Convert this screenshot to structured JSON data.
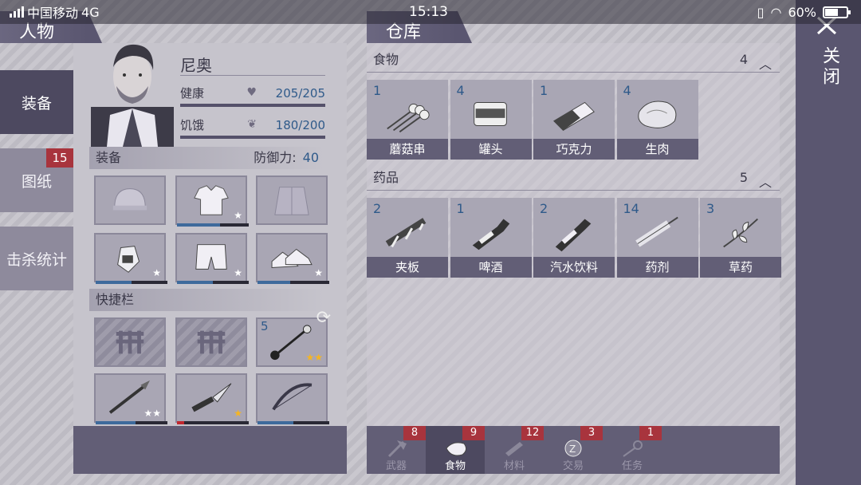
{
  "status_bar": {
    "carrier": "中国移动",
    "network": "4G",
    "time": "15:13",
    "battery": "60%",
    "battery_level": 0.6
  },
  "tabs": {
    "character": "人物",
    "warehouse": "仓库",
    "close": "关闭"
  },
  "left_nav": [
    {
      "label": "装备",
      "active": true
    },
    {
      "label": "图纸",
      "badge": "15"
    },
    {
      "label": "击杀统计"
    }
  ],
  "character": {
    "name": "尼奥",
    "health_label": "健康",
    "health_value": "205/205",
    "hunger_label": "饥饿",
    "hunger_value": "180/200"
  },
  "equipment": {
    "label": "装备",
    "defense_label": "防御力:",
    "defense_value": "40",
    "slots": [
      {
        "icon": "helmet-icon",
        "durability": 0,
        "stars": ""
      },
      {
        "icon": "shirt-icon",
        "durability": 0.6,
        "stars": "★"
      },
      {
        "icon": "jacket-icon",
        "durability": 0,
        "stars": ""
      },
      {
        "icon": "gloves-icon",
        "durability": 0.5,
        "stars": "★"
      },
      {
        "icon": "shorts-icon",
        "durability": 0.5,
        "stars": "★"
      },
      {
        "icon": "shoes-icon",
        "durability": 0.45,
        "stars": "★"
      }
    ]
  },
  "quickbar": {
    "label": "快捷栏",
    "slots": [
      {
        "icon": "locked-slot-icon",
        "locked": true
      },
      {
        "icon": "locked-slot-icon",
        "locked": true
      },
      {
        "icon": "mace-icon",
        "count": "5",
        "stars": "★★",
        "gold": true
      },
      {
        "icon": "spear-icon",
        "durability": 0.55,
        "stars": "★★",
        "gold": false
      },
      {
        "icon": "knife-icon",
        "durability": 0.1,
        "stars": "★",
        "gold": true,
        "low": true
      },
      {
        "icon": "bow-icon",
        "durability": 0.5,
        "stars": ""
      }
    ]
  },
  "warehouse": {
    "categories": [
      {
        "name": "食物",
        "count": "4",
        "items": [
          {
            "qty": "1",
            "name": "蘑菇串",
            "icon": "mushroom-skewer-icon"
          },
          {
            "qty": "4",
            "name": "罐头",
            "icon": "can-icon"
          },
          {
            "qty": "1",
            "name": "巧克力",
            "icon": "chocolate-icon"
          },
          {
            "qty": "4",
            "name": "生肉",
            "icon": "raw-meat-icon"
          }
        ]
      },
      {
        "name": "药品",
        "count": "5",
        "items": [
          {
            "qty": "2",
            "name": "夹板",
            "icon": "splint-icon"
          },
          {
            "qty": "1",
            "name": "啤酒",
            "icon": "beer-icon"
          },
          {
            "qty": "2",
            "name": "汽水饮料",
            "icon": "soda-icon"
          },
          {
            "qty": "14",
            "name": "药剂",
            "icon": "syringe-icon"
          },
          {
            "qty": "3",
            "name": "草药",
            "icon": "herb-icon"
          }
        ]
      }
    ]
  },
  "bottom_tabs": [
    {
      "label": "武器",
      "badge": "8",
      "icon": "axe-icon"
    },
    {
      "label": "食物",
      "badge": "9",
      "icon": "meat-icon",
      "active": true
    },
    {
      "label": "材料",
      "badge": "12",
      "icon": "material-icon"
    },
    {
      "label": "交易",
      "badge": "3",
      "icon": "coin-icon"
    },
    {
      "label": "任务",
      "badge": "1",
      "icon": "key-icon"
    }
  ],
  "colors": {
    "panel": "#c6c4cc",
    "dark": "#625e76",
    "accent_blue": "#2f5a8a",
    "badge_red": "#a8343d"
  }
}
